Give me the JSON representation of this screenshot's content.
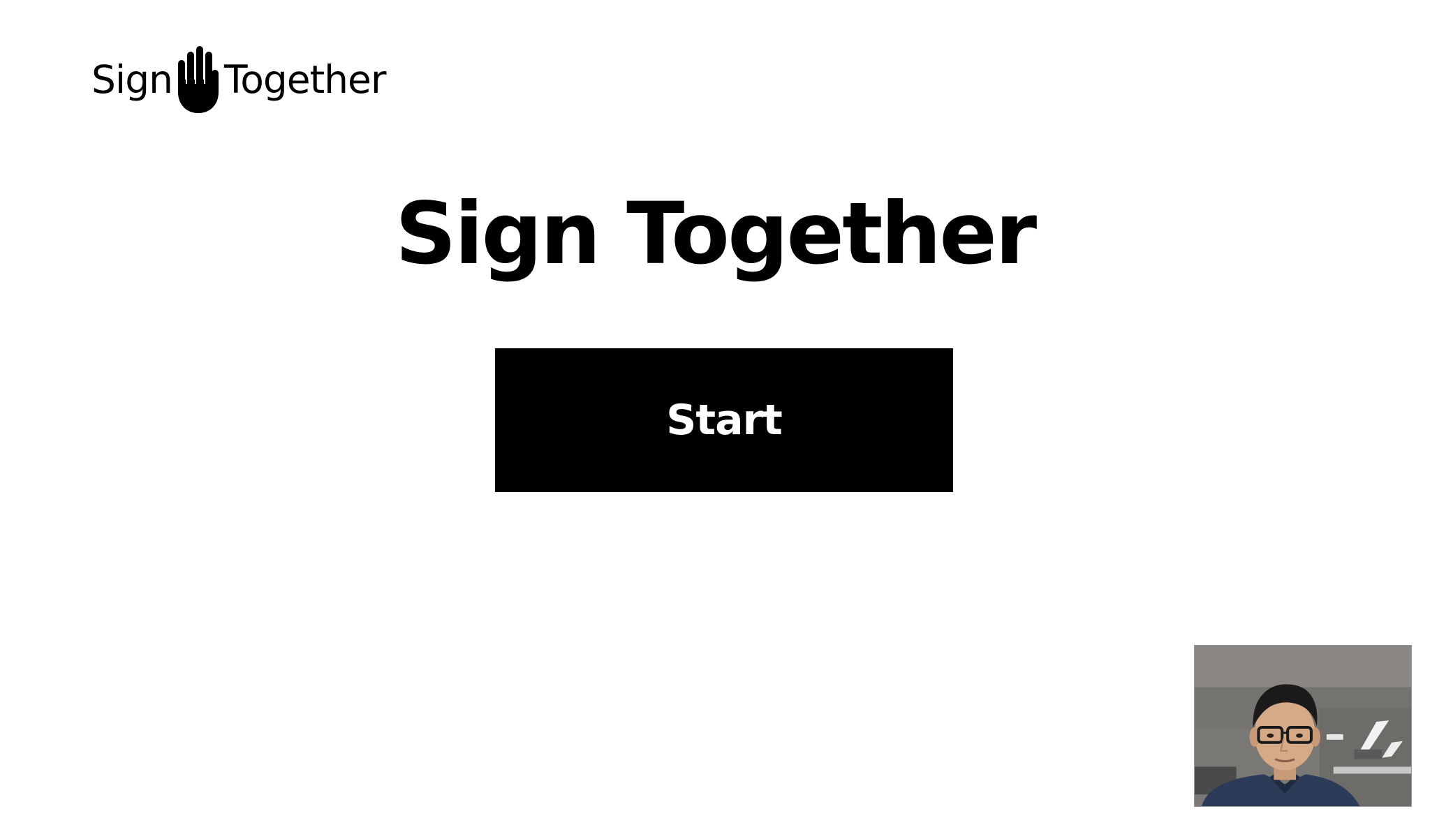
{
  "logo": {
    "text_left": "Sign",
    "text_right": "Together",
    "icon": "raised-hand-icon"
  },
  "title": "Sign Together",
  "start_button": {
    "label": "Start"
  },
  "webcam": {
    "icon": "webcam-preview"
  },
  "colors": {
    "background": "#ffffff",
    "foreground": "#000000",
    "button_text": "#ffffff"
  }
}
